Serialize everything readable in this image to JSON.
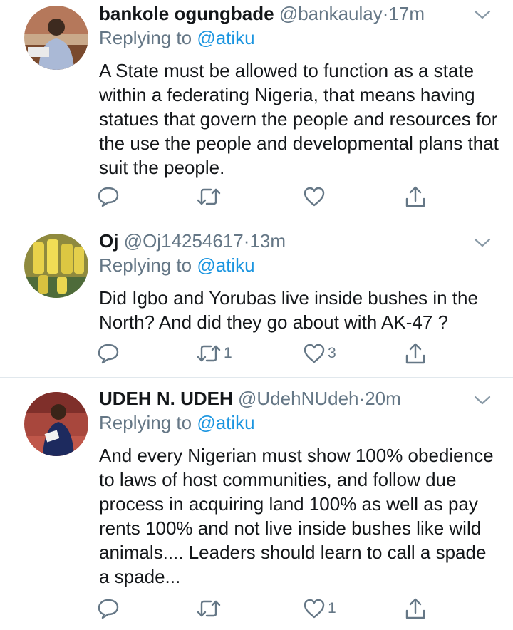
{
  "tweets": [
    {
      "name": "bankole ogungbade",
      "handle": "@bankaulay",
      "dot": "·",
      "time": "17m",
      "replying_prefix": "Replying to",
      "replying_to": "@atiku",
      "text": "A State must be allowed to function as a state within a federating Nigeria, that means having statues that govern the people and resources for the use the people and developmental plans that suit the people.",
      "retweets": "",
      "likes": ""
    },
    {
      "name": "Oj",
      "handle": "@Oj14254617",
      "dot": "·",
      "time": "13m",
      "replying_prefix": "Replying to",
      "replying_to": "@atiku",
      "text": "Did Igbo and Yorubas live inside bushes in the North? And did they go about with AK-47 ?",
      "retweets": "1",
      "likes": "3"
    },
    {
      "name": "UDEH N. UDEH",
      "handle": "@UdehNUdeh",
      "dot": "·",
      "time": "20m",
      "replying_prefix": "Replying to",
      "replying_to": "@atiku",
      "text": "And every Nigerian must show 100% obedience to laws of host communities, and follow due process in acquiring land 100% as well as pay rents 100% and not live inside bushes like wild animals.... Leaders should learn to call a spade a spade...",
      "retweets": "",
      "likes": "1"
    }
  ],
  "icons": {
    "reply": "reply-icon",
    "retweet": "retweet-icon",
    "like": "like-icon",
    "share": "share-icon",
    "more": "chevron-down-icon"
  },
  "colors": {
    "name": "#14171a",
    "secondary": "#657786",
    "link": "#1b95e0",
    "divider": "#e1e8ed"
  }
}
